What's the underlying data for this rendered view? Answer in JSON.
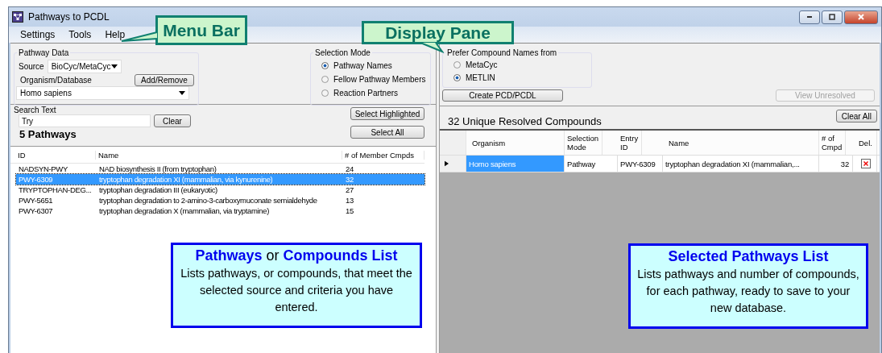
{
  "window": {
    "title": "Pathways to PCDL"
  },
  "menu": [
    "Settings",
    "Tools",
    "Help"
  ],
  "callouts": [
    "Menu Bar",
    "Display Pane"
  ],
  "pathway_data": {
    "title": "Pathway Data",
    "source_label": "Source",
    "source_value": "BioCyc/MetaCyc",
    "organism_label": "Organism/Database",
    "add_button": "Add/Remove",
    "organism_value": "Homo sapiens"
  },
  "selection_mode": {
    "title": "Selection Mode",
    "options": [
      {
        "label": "Pathway Names",
        "selected": true
      },
      {
        "label": "Fellow Pathway Members",
        "selected": false
      },
      {
        "label": "Reaction Partners",
        "selected": false
      }
    ]
  },
  "search": {
    "label": "Search Text",
    "value": "Try",
    "clear_button": "Clear"
  },
  "list_buttons": [
    "Select Highlighted",
    "Select All"
  ],
  "count": "5 Pathways",
  "pathways_table": {
    "columns": [
      "ID",
      "Name",
      "# of Member Cmpds"
    ],
    "rows": [
      {
        "cells": [
          "NADSYN-PWY",
          "NAD biosynthesis II (from tryptophan)",
          "24"
        ],
        "selected": false
      },
      {
        "cells": [
          "PWY-6309",
          "tryptophan degradation XI (mammalian, via kynurenine)",
          "32"
        ],
        "selected": true
      },
      {
        "cells": [
          "TRYPTOPHAN-DEG...",
          "tryptophan degradation III (eukaryotic)",
          "27"
        ],
        "selected": false
      },
      {
        "cells": [
          "PWY-5651",
          "tryptophan degradation to 2-amino-3-carboxymuconate semialdehyde",
          "13"
        ],
        "selected": false
      },
      {
        "cells": [
          "PWY-6307",
          "tryptophan degradation X (mammalian, via tryptamine)",
          "15"
        ],
        "selected": false
      }
    ]
  },
  "prefer": {
    "title": "Prefer Compound Names from",
    "options": [
      {
        "label": "MetaCyc",
        "selected": false
      },
      {
        "label": "METLIN",
        "selected": true
      }
    ]
  },
  "create_button": "Create PCD/PCDL",
  "view_unresolved": {
    "label": "View Unresolved",
    "disabled": true
  },
  "resolved_heading": "32 Unique Resolved Compounds",
  "clear_all": "Clear All",
  "selected_table": {
    "columns": [
      "Organism",
      "Selection Mode",
      "Entry ID",
      "Name",
      "# of Cmpd",
      "Del."
    ],
    "rows": [
      {
        "cells": [
          "Homo sapiens",
          "Pathway",
          "PWY-6309",
          "tryptophan degradation XI (mammalian,...",
          "32"
        ],
        "selected": true
      }
    ]
  },
  "notes": [
    {
      "title": "**Pathways** or **Compounds List**",
      "body": "Lists pathways, or compounds, that meet the selected source and criteria you have entered."
    },
    {
      "title": "Selected Pathways List",
      "body": "Lists pathways and number of compounds, for each pathway, ready to save to your new database."
    }
  ]
}
